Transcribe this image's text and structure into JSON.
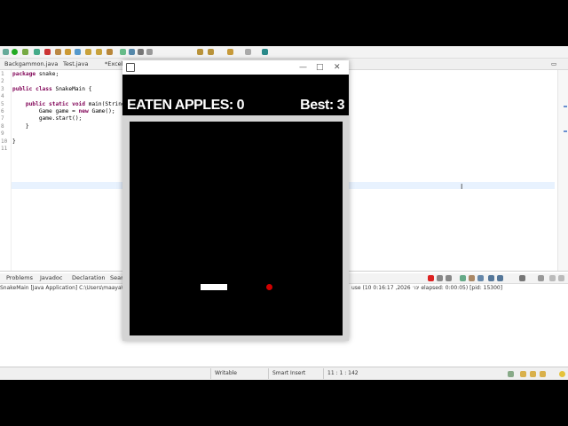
{
  "ide": {
    "tabs": [
      "Backgammon.java",
      "Test.java",
      "*Excel"
    ],
    "code_lines": [
      {
        "n": "1",
        "text": "package snake;"
      },
      {
        "n": "2",
        "text": ""
      },
      {
        "n": "3",
        "text": "public class SnakeMain {"
      },
      {
        "n": "4",
        "text": ""
      },
      {
        "n": "5",
        "text": "    public static void main(String[] args) {"
      },
      {
        "n": "6",
        "text": "        Game game = new Game();"
      },
      {
        "n": "7",
        "text": "        game.start();"
      },
      {
        "n": "8",
        "text": "    }"
      },
      {
        "n": "9",
        "text": ""
      },
      {
        "n": "10",
        "text": "}"
      },
      {
        "n": "11",
        "text": ""
      }
    ],
    "panel_tabs": [
      "Problems",
      "Javadoc",
      "Declaration",
      "Search"
    ],
    "console_left": "SnakeMain [Java Application] C:\\Users\\maaya\\.p2\\pool\\",
    "console_right": "use  (10 0:16:17 ,2026 ינו׳ elapsed: 0:00:05) [pid: 15300]",
    "status": {
      "writable": "Writable",
      "insert": "Smart Insert",
      "position": "11 : 1 : 142"
    }
  },
  "game": {
    "score_label": "EATEN APPLES: 0",
    "best_label": "Best: 3",
    "eaten_apples": 0,
    "best": 3,
    "colors": {
      "background": "#000000",
      "snake": "#ffffff",
      "apple": "#d00000"
    }
  }
}
